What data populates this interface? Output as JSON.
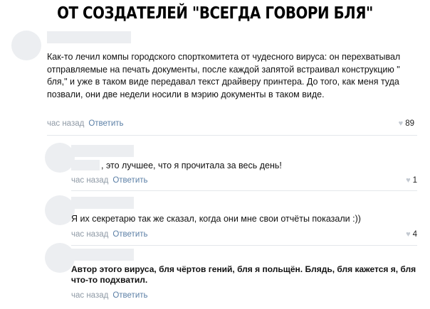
{
  "headline": "ОТ СОЗДАТЕЛЕЙ \"ВСЕГДА ГОВОРИ БЛЯ\"",
  "comments": [
    {
      "text": "Как-то лечил компы городского спорткомитета от чудесного вируса: он перехватывал отправляемые на печать документы, после каждой запятой встраивал конструкцию \" бля,\" и уже в таком виде передавал текст драйверу принтера. До того, как меня туда позвали, они две недели носили в мэрию документы в таком виде.",
      "time": "час назад",
      "reply": "Ответить",
      "likes": "89"
    },
    {
      "text": ", это лучшее, что я прочитала за весь день!",
      "time": "час назад",
      "reply": "Ответить",
      "likes": "1"
    },
    {
      "text": "Я их секретарю так же сказал, когда они мне свои отчёты показали :))",
      "time": "час назад",
      "reply": "Ответить",
      "likes": "4"
    },
    {
      "text": "Автор этого вируса, бля чёртов гений, бля я польщён. Блядь, бля кажется я, бля что-то подхватил.",
      "time": "час назад",
      "reply": "Ответить"
    }
  ],
  "icons": {
    "like": "heart-icon"
  }
}
